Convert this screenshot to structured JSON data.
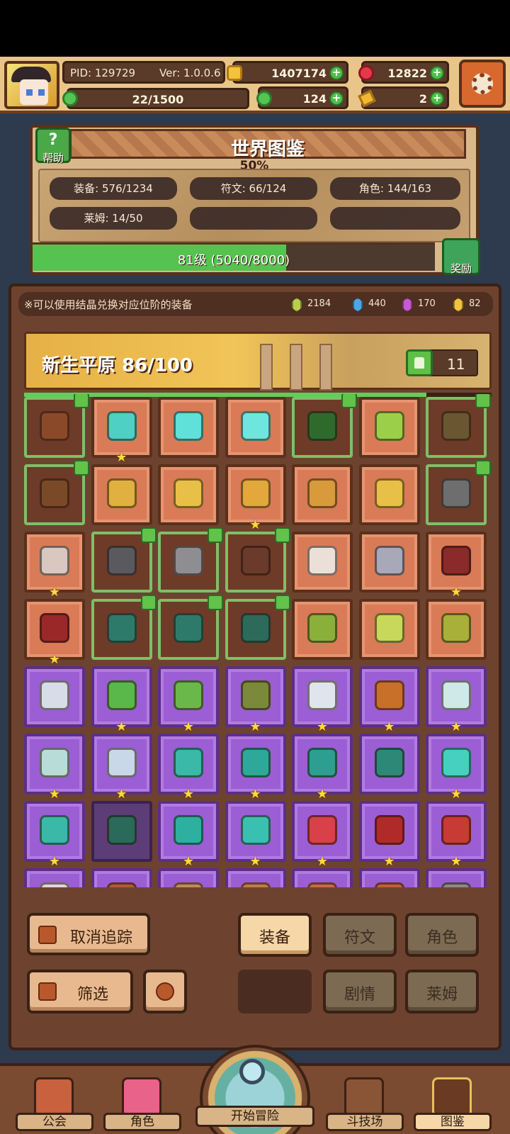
{
  "header": {
    "pid": "PID: 129729",
    "version": "Ver: 1.0.0.6",
    "gold": "1407174",
    "rubies": "12822",
    "stamina": "22/1500",
    "clovers": "124",
    "keys": "2",
    "plus": "+"
  },
  "codex": {
    "help_label": "帮助",
    "title": "世界图鉴",
    "completion": "50%",
    "stats": {
      "equipment": "装备: 576/1234",
      "runes": "符文: 66/124",
      "characters": "角色: 144/163",
      "slimes": "莱姆: 14/50"
    },
    "level_text": "81级 (5040/8000)",
    "level_progress": 0.63,
    "reward_label": "奖励"
  },
  "notice": "※可以使用结晶兑换对应位阶的装备",
  "crystals": [
    {
      "color": "#b9cf4a",
      "count": "2184"
    },
    {
      "color": "#4aa8e8",
      "count": "440"
    },
    {
      "color": "#c75ad3",
      "count": "170"
    },
    {
      "color": "#f2c33b",
      "count": "82"
    }
  ],
  "region": {
    "title": "新生平原 86/100",
    "progress": 0.86,
    "tracked_count": "11"
  },
  "grid_rows": [
    [
      [
        "brown",
        "#8a4a2a",
        false,
        true
      ],
      [
        "orange",
        "#4fd0c4",
        true,
        false
      ],
      [
        "orange",
        "#5fe0d8",
        false,
        false
      ],
      [
        "orange",
        "#6ee6de",
        false,
        false
      ],
      [
        "brown",
        "#2f6a2d",
        false,
        true
      ],
      [
        "orange",
        "#9bcf4a",
        false,
        false
      ],
      [
        "brown",
        "#6a5630",
        false,
        true
      ]
    ],
    [
      [
        "brown",
        "#7a4a28",
        false,
        true
      ],
      [
        "orange",
        "#e0b040",
        false,
        false
      ],
      [
        "orange",
        "#e8c048",
        false,
        false
      ],
      [
        "orange",
        "#e2a83c",
        true,
        false
      ],
      [
        "orange",
        "#d99a3c",
        false,
        false
      ],
      [
        "orange",
        "#e8c048",
        false,
        false
      ],
      [
        "brown",
        "#6e6e6e",
        false,
        true
      ]
    ],
    [
      [
        "orange",
        "#d8c8c0",
        true,
        false
      ],
      [
        "brown",
        "#5a5a5e",
        false,
        true
      ],
      [
        "brown",
        "#8e8e92",
        false,
        true
      ],
      [
        "brown",
        "#6a3a2a",
        false,
        true
      ],
      [
        "orange",
        "#eae0d8",
        false,
        false
      ],
      [
        "orange",
        "#a8a8b8",
        false,
        false
      ],
      [
        "orange",
        "#8a2a2a",
        true,
        false
      ]
    ],
    [
      [
        "orange",
        "#9a2828",
        true,
        false
      ],
      [
        "brown",
        "#2e7a6a",
        false,
        true
      ],
      [
        "brown",
        "#2e7a6a",
        false,
        true
      ],
      [
        "brown",
        "#2e6a5a",
        false,
        true
      ],
      [
        "orange",
        "#8ab03a",
        false,
        false
      ],
      [
        "orange",
        "#c8d85a",
        false,
        false
      ],
      [
        "orange",
        "#a8b03a",
        false,
        false
      ]
    ],
    [
      [
        "purple",
        "#d8dce8",
        false,
        false
      ],
      [
        "purple",
        "#5ab84a",
        true,
        false
      ],
      [
        "purple",
        "#6ab84a",
        true,
        false
      ],
      [
        "purple",
        "#7a8a3a",
        true,
        false
      ],
      [
        "purple",
        "#e0e4ec",
        true,
        false
      ],
      [
        "purple",
        "#c8702a",
        true,
        false
      ],
      [
        "purple",
        "#cfe8e8",
        true,
        false
      ]
    ],
    [
      [
        "purple",
        "#b8dcd8",
        true,
        false
      ],
      [
        "purple",
        "#c8d8e8",
        true,
        false
      ],
      [
        "purple",
        "#3ab8a8",
        true,
        false
      ],
      [
        "purple",
        "#2ea898",
        true,
        false
      ],
      [
        "purple",
        "#2e9e90",
        true,
        false
      ],
      [
        "purple",
        "#2e8878",
        false,
        false
      ],
      [
        "purple",
        "#46d0c0",
        true,
        false
      ]
    ],
    [
      [
        "purple",
        "#3ab8a8",
        true,
        false
      ],
      [
        "dark",
        "#2a6a5a",
        false,
        false
      ],
      [
        "purple",
        "#2eb0a0",
        true,
        false
      ],
      [
        "purple",
        "#3ac0b0",
        true,
        false
      ],
      [
        "purple",
        "#d8404a",
        true,
        false
      ],
      [
        "purple",
        "#b02a2a",
        true,
        false
      ],
      [
        "purple",
        "#c83a34",
        true,
        false
      ]
    ],
    [
      [
        "purple",
        "#e0d4d8",
        false,
        false
      ],
      [
        "purple",
        "#b05a3a",
        false,
        false
      ],
      [
        "purple",
        "#c08a5a",
        false,
        false
      ],
      [
        "purple",
        "#c07a4a",
        false,
        false
      ],
      [
        "purple",
        "#c8684a",
        false,
        false
      ],
      [
        "purple",
        "#c0603a",
        false,
        false
      ],
      [
        "purple",
        "#8a8a8a",
        false,
        false
      ]
    ]
  ],
  "controls": {
    "untrack": "取消追踪",
    "filter": "筛选",
    "tab_equipment": "装备",
    "tab_runes": "符文",
    "tab_characters": "角色",
    "tab_story": "剧情",
    "tab_slimes": "莱姆"
  },
  "nav": {
    "guild": "公会",
    "characters": "角色",
    "adventure": "开始冒险",
    "arena": "斗技场",
    "codex": "图鉴"
  },
  "colors": {
    "accent_green": "#56c24f",
    "panel_brown": "#6d4330",
    "rare_purple": "#9b5ed4",
    "common_orange": "#d97b56"
  }
}
